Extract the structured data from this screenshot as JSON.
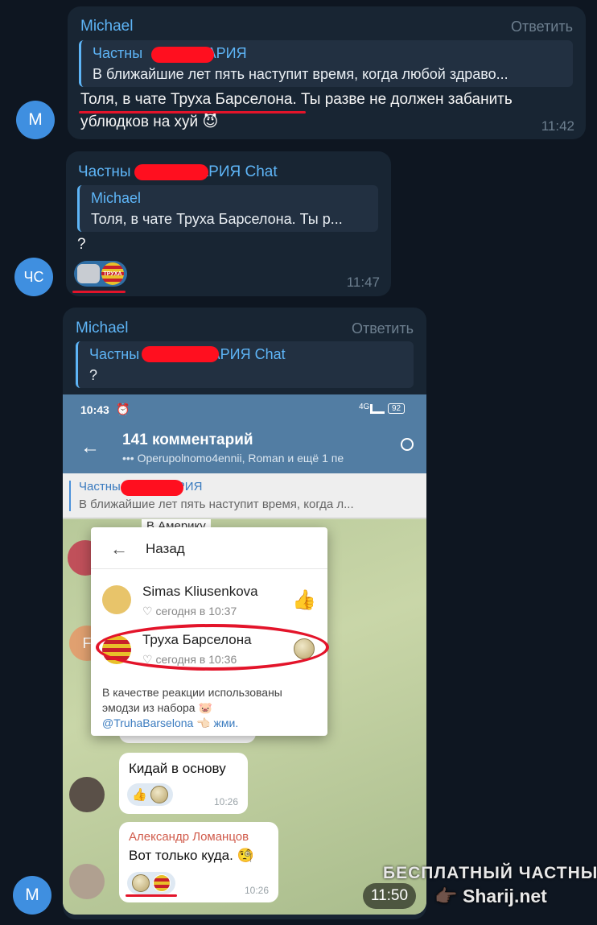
{
  "messages": [
    {
      "sender": "Michael",
      "reply_action": "Ответить",
      "avatar_initials": "M",
      "quote_name": "Частны       ШАРИЯ",
      "quote_text": "В ближайшие лет пять наступит время, когда любой здраво...",
      "text_line1": "Толя, в чате Труха Барселона. Ты разве не должен забанить",
      "text_line2": "ублюдков на хуй 😈",
      "time": "11:42"
    },
    {
      "sender": "Частны       ШАРИЯ Chat",
      "avatar_initials": "ЧС",
      "quote_name": "Michael",
      "quote_text": "Толя, в чате Труха Барселона. Ты р...",
      "text": "?",
      "reaction_label": "ТРУХА",
      "time": "11:47"
    },
    {
      "sender": "Michael",
      "reply_action": "Ответить",
      "avatar_initials": "M",
      "quote_name": "Частны        ШАРИЯ Chat",
      "quote_text": "?",
      "time": "11:50"
    }
  ],
  "screenshot": {
    "status_time": "10:43",
    "battery": "92",
    "network": "4G",
    "title": "141 комментарий",
    "subtitle": "••• Operupolnomo4ennii, Roman и ещё 1 пе",
    "pinned_name": "Частны        АРИЯ",
    "pinned_text": "В ближайшие лет пять наступит время, когда л...",
    "behind_text": "В Америку",
    "popup": {
      "back_label": "Назад",
      "rows": [
        {
          "name": "Simas Kliusenkova",
          "sub": "♡ сегодня в 10:37",
          "reaction": "👍"
        },
        {
          "name": "Труха Барселона",
          "sub": "♡ сегодня в 10:36",
          "reaction": "coin"
        }
      ],
      "footer_text": "В качестве реакции использованы эмодзи из набора",
      "footer_link": "@TruhaBarselona",
      "footer_suffix": "жми."
    },
    "chat": [
      {
        "time": "10:26"
      },
      {
        "text": "Кидай в основу",
        "time": "10:26",
        "reaction": "👍"
      },
      {
        "name": "Александр Ломанцов",
        "text": "Вот только куда. 🧐",
        "time": "10:26"
      }
    ],
    "avatar_letter": "F"
  },
  "watermark": {
    "line1": "БЕСПЛАТНЫЙ ЧАСТНЫЙ",
    "line2": "Sharij.net"
  }
}
